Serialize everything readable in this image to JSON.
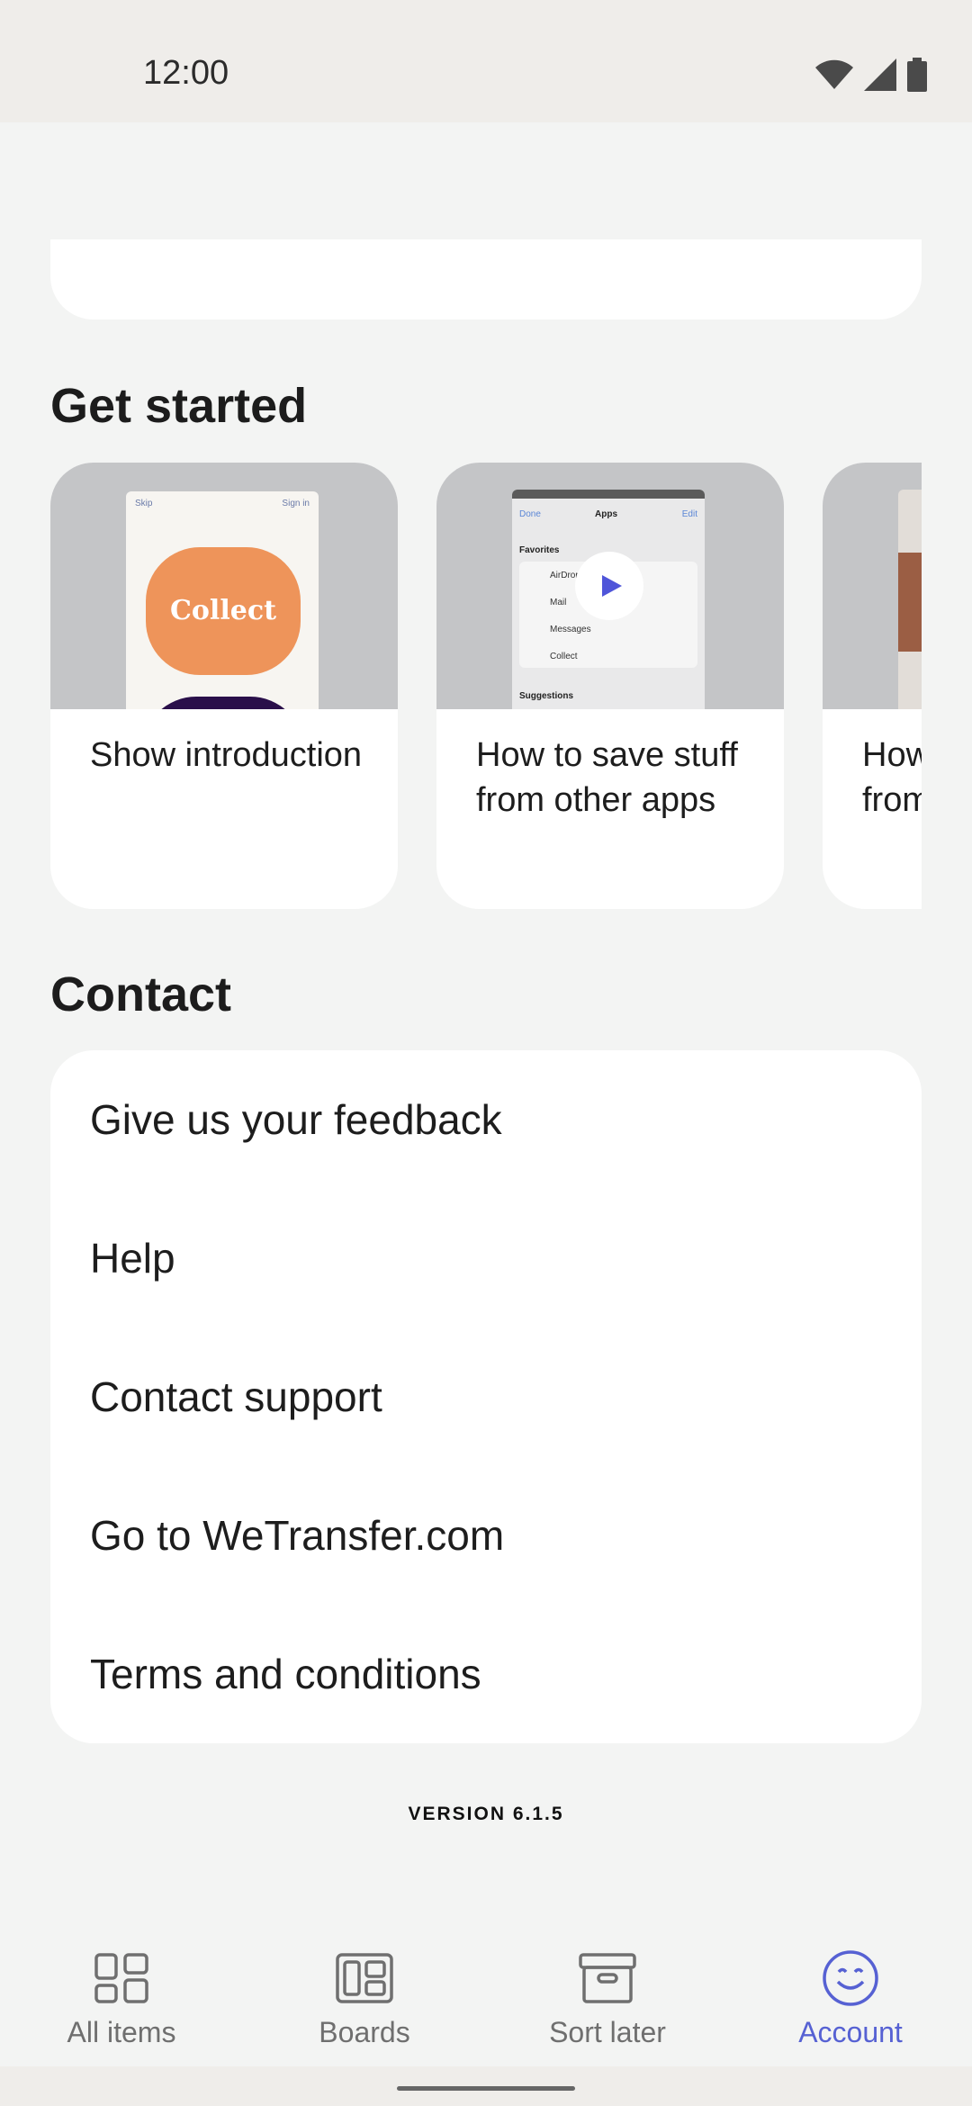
{
  "status_bar": {
    "time": "12:00"
  },
  "get_started": {
    "title": "Get started",
    "cards": [
      {
        "label": "Show introduction",
        "thumb_skip": "Skip",
        "thumb_signin": "Sign in",
        "thumb_brand": "Collect"
      },
      {
        "label": "How to save stuff from other apps",
        "thumb_done": "Done",
        "thumb_apps": "Apps",
        "thumb_edit": "Edit",
        "thumb_favorites": "Favorites",
        "thumb_rows": [
          "AirDrop",
          "Mail",
          "Messages",
          "Collect"
        ],
        "thumb_suggestions": "Suggestions"
      },
      {
        "label": "How to save stuff from Chrome"
      }
    ]
  },
  "contact": {
    "title": "Contact",
    "items": [
      "Give us your feedback",
      "Help",
      "Contact support",
      "Go to WeTransfer.com",
      "Terms and conditions"
    ]
  },
  "version": "VERSION 6.1.5",
  "bottom_nav": {
    "items": [
      {
        "label": "All items",
        "icon": "grid-icon"
      },
      {
        "label": "Boards",
        "icon": "boards-icon"
      },
      {
        "label": "Sort later",
        "icon": "archive-box-icon"
      },
      {
        "label": "Account",
        "icon": "smiley-icon"
      }
    ],
    "active_color": "#5661d3",
    "inactive_color": "#6f6f6f"
  }
}
